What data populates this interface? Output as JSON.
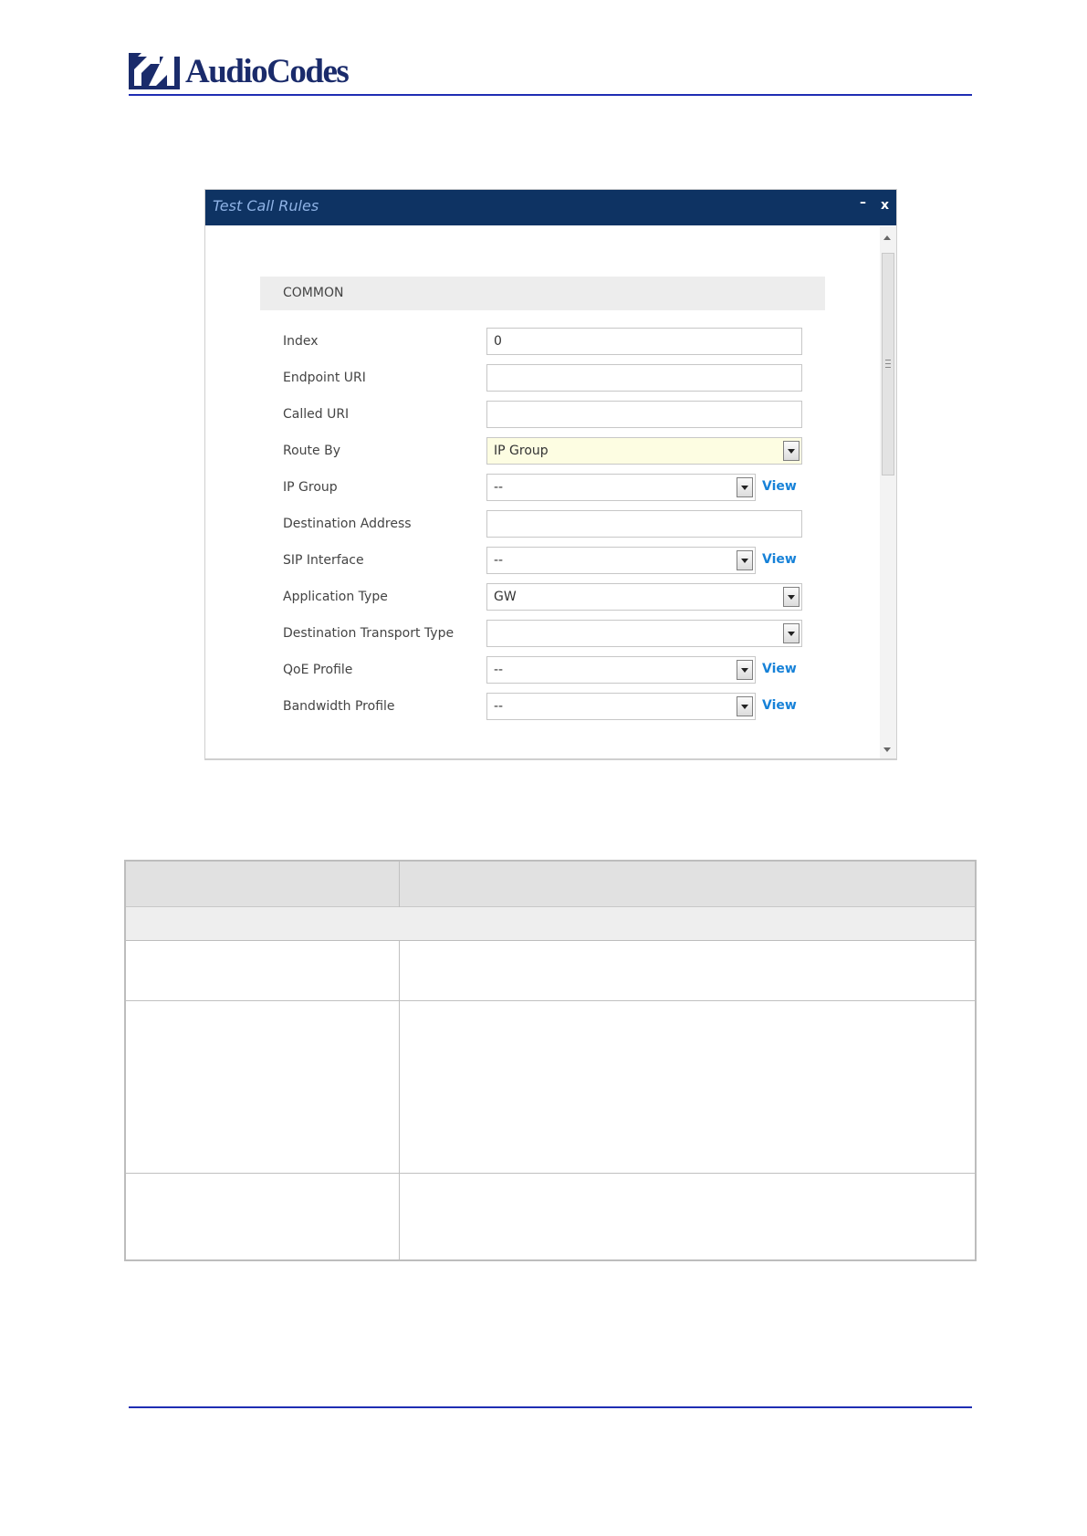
{
  "header": {
    "brand": "AudioCodes",
    "brand_color": "#1a2b6b",
    "rule_color": "#1f2db3"
  },
  "dialog": {
    "title": "Test Call Rules",
    "minimize_label": "–",
    "close_label": "x",
    "title_bar_color": "#0e3363",
    "section": "COMMON",
    "fields": {
      "index": {
        "label": "Index",
        "value": "0"
      },
      "endpoint_uri": {
        "label": "Endpoint URI",
        "value": ""
      },
      "called_uri": {
        "label": "Called URI",
        "value": ""
      },
      "route_by": {
        "label": "Route By",
        "value": "IP Group"
      },
      "ip_group": {
        "label": "IP Group",
        "value": "--",
        "link": "View"
      },
      "destination_address": {
        "label": "Destination Address",
        "value": ""
      },
      "sip_interface": {
        "label": "SIP Interface",
        "value": "--",
        "link": "View"
      },
      "application_type": {
        "label": "Application Type",
        "value": "GW"
      },
      "destination_transport_type": {
        "label": "Destination Transport Type",
        "value": ""
      },
      "qoe_profile": {
        "label": "QoE Profile",
        "value": "--",
        "link": "View"
      },
      "bandwidth_profile": {
        "label": "Bandwidth Profile",
        "value": "--",
        "link": "View"
      }
    }
  }
}
